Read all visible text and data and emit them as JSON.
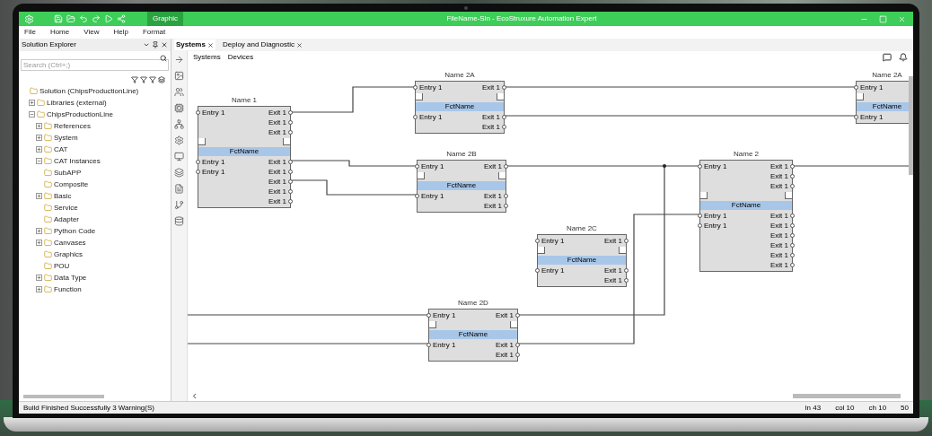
{
  "window": {
    "title": "FileName-Sln - EcoStruxure Automation Expert",
    "ribbon_tab": {
      "label": "Graphic",
      "selected": true
    }
  },
  "menu": [
    "File",
    "Home",
    "View",
    "Help",
    "Format"
  ],
  "solution_explorer": {
    "title": "Solution Explorer",
    "search": {
      "placeholder": "Search (Ctrl+;)"
    },
    "tree": [
      {
        "label": "Solution (ChipsProductionLine)",
        "children": [
          {
            "label": "Libraries (external)",
            "expanded": false
          },
          {
            "label": "ChipsProductionLine",
            "expanded": true,
            "children": [
              {
                "label": "References",
                "expanded": false
              },
              {
                "label": "System",
                "expanded": false
              },
              {
                "label": "CAT",
                "expanded": false
              },
              {
                "label": "CAT Instances",
                "expanded": true
              },
              {
                "label": "SubAPP"
              },
              {
                "label": "Composite"
              },
              {
                "label": "Basic",
                "expanded": false
              },
              {
                "label": "Service"
              },
              {
                "label": "Adapter"
              },
              {
                "label": "Python Code",
                "expanded": false
              },
              {
                "label": "Canvases",
                "expanded": false
              },
              {
                "label": "Graphics"
              },
              {
                "label": "POU"
              },
              {
                "label": "Data Type",
                "expanded": false
              },
              {
                "label": "Function",
                "expanded": false
              }
            ]
          }
        ]
      }
    ]
  },
  "editor_tabs": [
    {
      "label": "Systems",
      "selected": true
    },
    {
      "label": "Deploy and Diagnostic",
      "selected": false
    }
  ],
  "breadcrumb": [
    "Systems",
    "Devices"
  ],
  "blocks": [
    {
      "title": "Name 1",
      "top": {
        "entries": [
          "Entry 1"
        ],
        "exits": [
          "Exit 1",
          "Exit 1",
          "Exit 1"
        ]
      },
      "function": "FctName",
      "bottom": {
        "entries": [
          "Entry 1",
          "Entry 1"
        ],
        "exits": [
          "Exit 1",
          "Exit 1",
          "Exit 1",
          "Exit 1",
          "Exit 1"
        ]
      }
    },
    {
      "title": "Name 2A",
      "top": {
        "entries": [
          "Entry 1"
        ],
        "exits": [
          "Exit 1"
        ]
      },
      "function": "FctName",
      "bottom": {
        "entries": [
          "Entry 1"
        ],
        "exits": [
          "Exit 1",
          "Exit 1"
        ]
      }
    },
    {
      "title": "Name 2B",
      "top": {
        "entries": [
          "Entry 1"
        ],
        "exits": [
          "Exit 1"
        ]
      },
      "function": "FctName",
      "bottom": {
        "entries": [
          "Entry 1"
        ],
        "exits": [
          "Exit 1",
          "Exit 1"
        ]
      }
    },
    {
      "title": "Name 2C",
      "top": {
        "entries": [
          "Entry 1"
        ],
        "exits": [
          "Exit 1"
        ]
      },
      "function": "FctName",
      "bottom": {
        "entries": [
          "Entry 1"
        ],
        "exits": [
          "Exit 1",
          "Exit 1"
        ]
      }
    },
    {
      "title": "Name 2D",
      "top": {
        "entries": [
          "Entry 1"
        ],
        "exits": [
          "Exit 1"
        ]
      },
      "function": "FctName",
      "bottom": {
        "entries": [
          "Entry 1"
        ],
        "exits": [
          "Exit 1",
          "Exit 1"
        ]
      }
    },
    {
      "title": "Name 2",
      "top": {
        "entries": [
          "Entry 1"
        ],
        "exits": [
          "Exit 1",
          "Exit 1",
          "Exit 1"
        ]
      },
      "function": "FctName",
      "bottom": {
        "entries": [
          "Entry 1",
          "Entry 1"
        ],
        "exits": [
          "Exit 1",
          "Exit 1",
          "Exit 1",
          "Exit 1",
          "Exit 1",
          "Exit 1"
        ]
      }
    },
    {
      "title": "Name 2A",
      "top": {
        "entries": [
          "Entry 1"
        ]
      },
      "function": "FctName",
      "bottom": {
        "entries": [
          "Entry 1"
        ]
      }
    }
  ],
  "status_bar": {
    "message": "Build Finished Successfully 3 Warning(S)",
    "fields": [
      "ln 43",
      "col 10",
      "ch 10",
      "50"
    ]
  }
}
